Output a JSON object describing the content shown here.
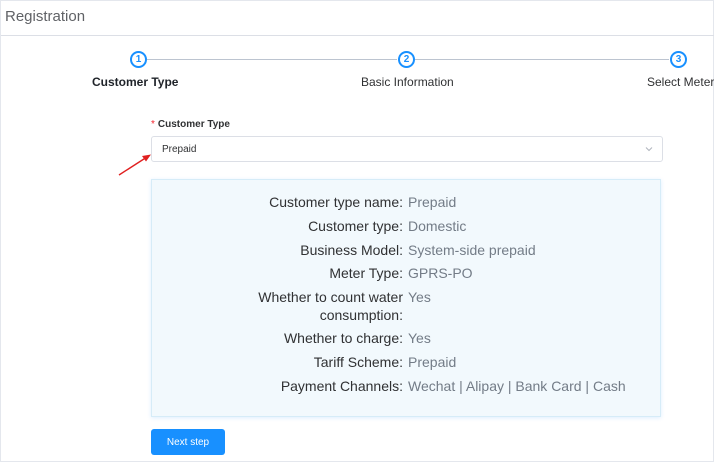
{
  "header": {
    "title": "Registration"
  },
  "steps": [
    {
      "number": "1",
      "label": "Customer Type"
    },
    {
      "number": "2",
      "label": "Basic Information"
    },
    {
      "number": "3",
      "label": "Select Meter"
    }
  ],
  "form": {
    "required_mark": "*",
    "customer_type_label": "Customer Type",
    "customer_type_value": "Prepaid"
  },
  "info": [
    {
      "key": "Customer type name:",
      "value": "Prepaid"
    },
    {
      "key": "Customer type:",
      "value": "Domestic"
    },
    {
      "key": "Business Model:",
      "value": "System-side prepaid"
    },
    {
      "key": "Meter Type:",
      "value": "GPRS-PO"
    },
    {
      "key_line1": "Whether to count water",
      "key_line2": "consumption:",
      "value": "Yes"
    },
    {
      "key": "Whether to charge:",
      "value": "Yes"
    },
    {
      "key": "Tariff Scheme:",
      "value": "Prepaid"
    },
    {
      "key": "Payment Channels:",
      "value": "Wechat | Alipay | Bank Card | Cash"
    }
  ],
  "actions": {
    "next_label": "Next step"
  },
  "colors": {
    "primary": "#1890ff",
    "required": "#f5222d",
    "annotation_arrow": "#e02020",
    "panel_bg": "#f2f9fd"
  }
}
